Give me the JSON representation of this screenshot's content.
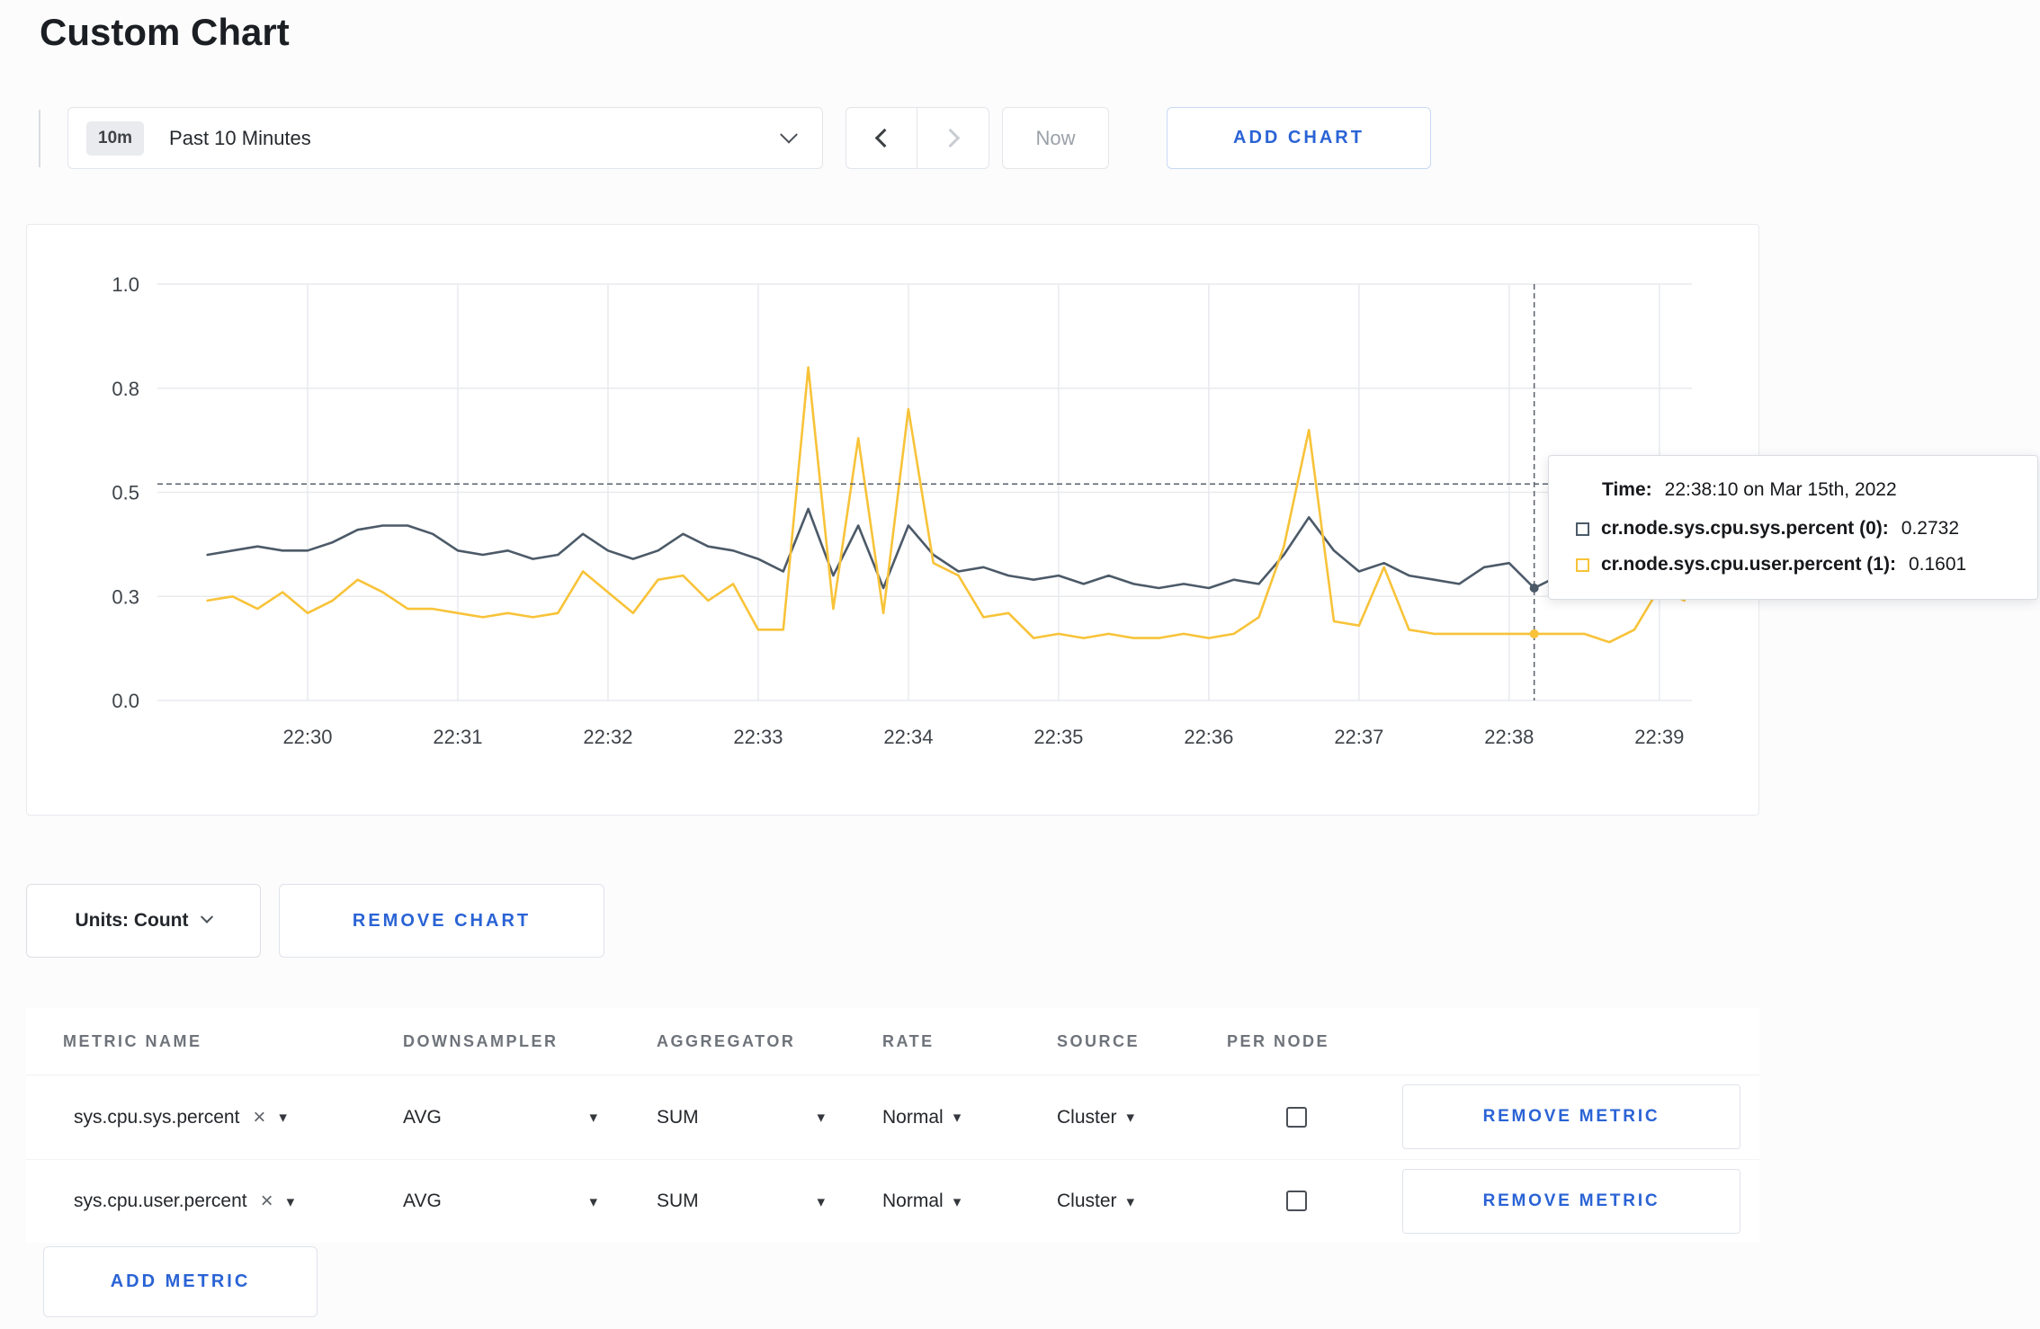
{
  "page": {
    "title": "Custom Chart"
  },
  "icons": {
    "clear": "×",
    "caret_down": "▾"
  },
  "colors": {
    "accent_blue": "#2A63D5",
    "series_sys": "#4C5A68",
    "series_user": "#F8C339",
    "grid": "#E8EAEE"
  },
  "toolbar": {
    "time_range_badge": "10m",
    "time_range_label": "Past 10 Minutes",
    "now_label": "Now",
    "add_chart_label": "ADD CHART"
  },
  "tooltip": {
    "time_label": "Time:",
    "time_value": "22:38:10 on Mar 15th, 2022",
    "series": [
      {
        "label": "cr.node.sys.cpu.sys.percent (0):",
        "value": "0.2732",
        "color": "#4C5A68"
      },
      {
        "label": "cr.node.sys.cpu.user.percent (1):",
        "value": "0.1601",
        "color": "#F8C339"
      }
    ]
  },
  "chart_controls": {
    "units_label": "Units: Count",
    "remove_chart_label": "REMOVE CHART"
  },
  "metrics_table": {
    "headers": [
      "METRIC NAME",
      "DOWNSAMPLER",
      "AGGREGATOR",
      "RATE",
      "SOURCE",
      "PER NODE"
    ],
    "rows": [
      {
        "metric": "sys.cpu.sys.percent",
        "downsampler": "AVG",
        "aggregator": "SUM",
        "rate": "Normal",
        "source": "Cluster",
        "per_node_checked": false,
        "remove_label": "REMOVE METRIC"
      },
      {
        "metric": "sys.cpu.user.percent",
        "downsampler": "AVG",
        "aggregator": "SUM",
        "rate": "Normal",
        "source": "Cluster",
        "per_node_checked": false,
        "remove_label": "REMOVE METRIC"
      }
    ],
    "add_metric_label": "ADD METRIC"
  },
  "chart_data": {
    "type": "line",
    "title": "",
    "xlabel": "time",
    "ylabel": "count",
    "x_unit_note": "seconds after 22:29:00 on Mar 15th, 2022",
    "xlim": [
      0,
      613
    ],
    "ylim": [
      0,
      1
    ],
    "grid": true,
    "legend_position": "tooltip-only",
    "x_ticks": [
      {
        "t": 60,
        "label": "22:30"
      },
      {
        "t": 120,
        "label": "22:31"
      },
      {
        "t": 180,
        "label": "22:32"
      },
      {
        "t": 240,
        "label": "22:33"
      },
      {
        "t": 300,
        "label": "22:34"
      },
      {
        "t": 360,
        "label": "22:35"
      },
      {
        "t": 420,
        "label": "22:36"
      },
      {
        "t": 480,
        "label": "22:37"
      },
      {
        "t": 540,
        "label": "22:38"
      },
      {
        "t": 600,
        "label": "22:39"
      }
    ],
    "y_ticks": [
      {
        "v": 0,
        "label": "0.0"
      },
      {
        "v": 0.25,
        "label": "0.3"
      },
      {
        "v": 0.5,
        "label": "0.5"
      },
      {
        "v": 0.75,
        "label": "0.8"
      },
      {
        "v": 1,
        "label": "1.0"
      }
    ],
    "x": [
      20,
      30,
      40,
      50,
      60,
      70,
      80,
      90,
      100,
      110,
      120,
      130,
      140,
      150,
      160,
      170,
      180,
      190,
      200,
      210,
      220,
      230,
      240,
      250,
      260,
      270,
      280,
      290,
      300,
      310,
      320,
      330,
      340,
      350,
      360,
      370,
      380,
      390,
      400,
      410,
      420,
      430,
      440,
      450,
      460,
      470,
      480,
      490,
      500,
      510,
      520,
      530,
      540,
      550,
      560,
      570,
      580,
      590,
      600,
      610
    ],
    "series": [
      {
        "name": "cr.node.sys.cpu.sys.percent",
        "color": "#4C5A68",
        "values": [
          0.35,
          0.36,
          0.37,
          0.36,
          0.36,
          0.38,
          0.41,
          0.42,
          0.42,
          0.4,
          0.36,
          0.35,
          0.36,
          0.34,
          0.35,
          0.4,
          0.36,
          0.34,
          0.36,
          0.4,
          0.37,
          0.36,
          0.34,
          0.31,
          0.46,
          0.3,
          0.42,
          0.27,
          0.42,
          0.35,
          0.31,
          0.32,
          0.3,
          0.29,
          0.3,
          0.28,
          0.3,
          0.28,
          0.27,
          0.28,
          0.27,
          0.29,
          0.28,
          0.35,
          0.44,
          0.36,
          0.31,
          0.33,
          0.3,
          0.29,
          0.28,
          0.32,
          0.33,
          0.27,
          0.3,
          0.31,
          0.3,
          0.3,
          0.31,
          0.3
        ]
      },
      {
        "name": "cr.node.sys.cpu.user.percent",
        "color": "#F8C339",
        "values": [
          0.24,
          0.25,
          0.22,
          0.26,
          0.21,
          0.24,
          0.29,
          0.26,
          0.22,
          0.22,
          0.21,
          0.2,
          0.21,
          0.2,
          0.21,
          0.31,
          0.26,
          0.21,
          0.29,
          0.3,
          0.24,
          0.28,
          0.17,
          0.17,
          0.8,
          0.22,
          0.63,
          0.21,
          0.7,
          0.33,
          0.3,
          0.2,
          0.21,
          0.15,
          0.16,
          0.15,
          0.16,
          0.15,
          0.15,
          0.16,
          0.15,
          0.16,
          0.2,
          0.37,
          0.65,
          0.19,
          0.18,
          0.32,
          0.17,
          0.16,
          0.16,
          0.16,
          0.16,
          0.16,
          0.16,
          0.16,
          0.14,
          0.17,
          0.27,
          0.24
        ]
      }
    ],
    "hover": {
      "t": 550,
      "crosshair_y_value": 0.52,
      "time_display": "22:38:10 on Mar 15th, 2022"
    }
  }
}
